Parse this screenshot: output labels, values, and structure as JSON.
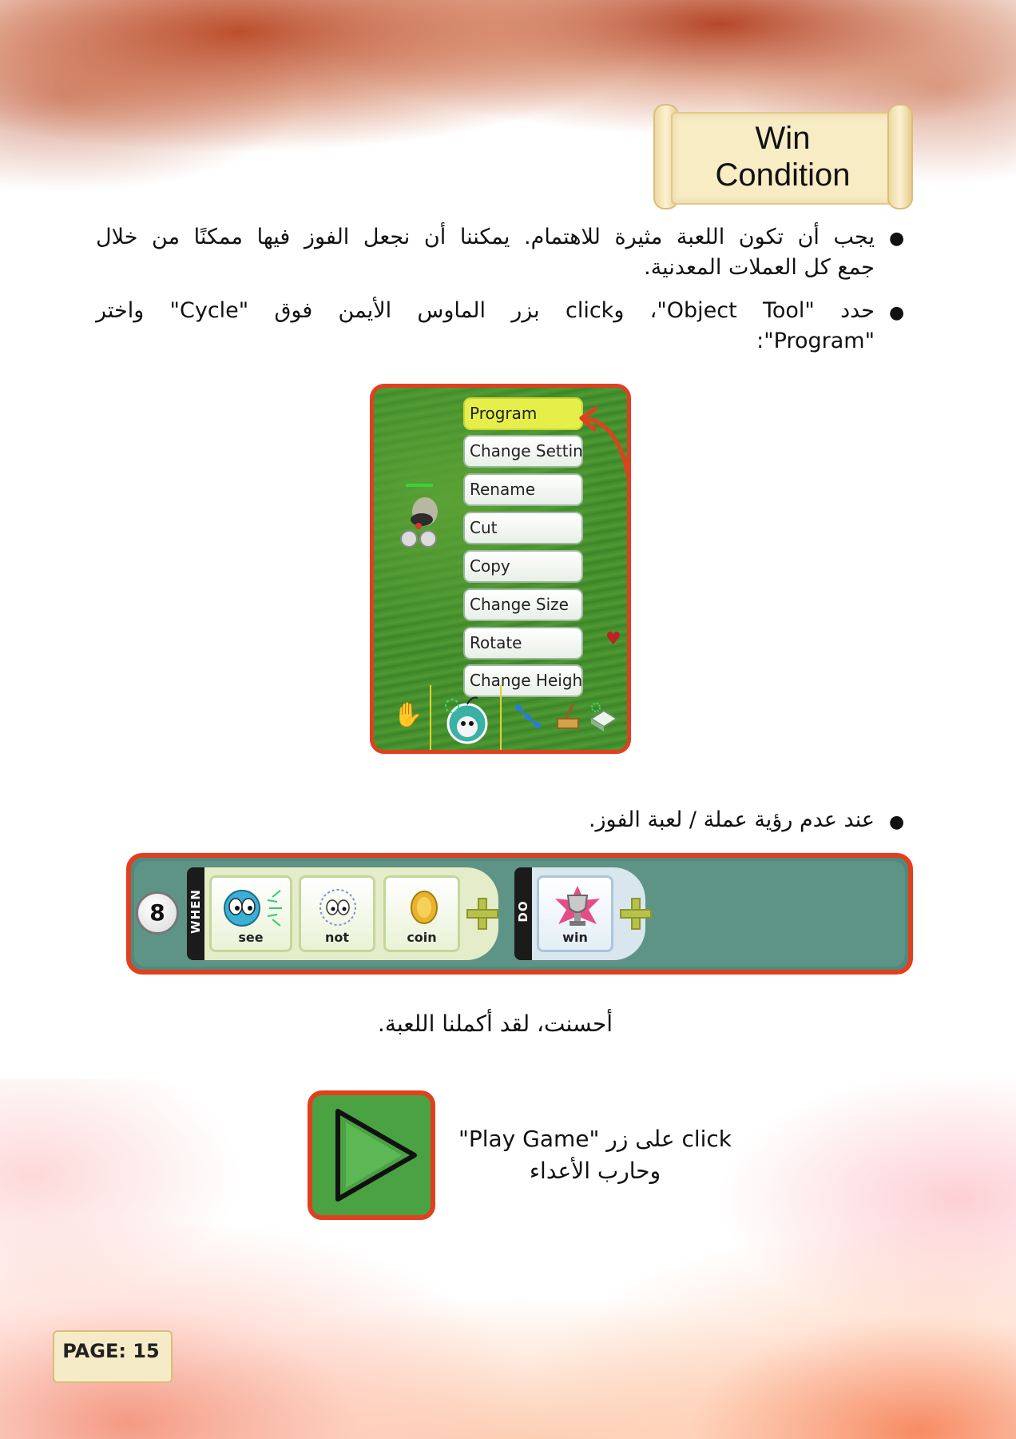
{
  "title": {
    "line1": "Win",
    "line2": "Condition"
  },
  "bullets": [
    {
      "line1": "يجب أن تكون اللعبة مثيرة للاهتمام. يمكننا أن نجعل الفوز فيها ممكنًا من خلال",
      "line2": "جمع كل العملات المعدنية."
    },
    {
      "line1": "حدد \"Object Tool\"، وclick بزر الماوس الأيمن فوق \"Cycle\" واختر",
      "line2": "\"Program\":"
    },
    {
      "line1": "عند عدم رؤية عملة / لعبة الفوز."
    }
  ],
  "context_menu": {
    "items": [
      "Program",
      "Change Settings",
      "Rename",
      "Cut",
      "Copy",
      "Change Size",
      "Rotate",
      "Change Height"
    ],
    "selected": "Program"
  },
  "program_row": {
    "number": "8",
    "when_label": "WHEN",
    "do_label": "DO",
    "when_tiles": [
      {
        "label": "see",
        "icon": "see-eyes-icon"
      },
      {
        "label": "not",
        "icon": "not-eyes-icon"
      },
      {
        "label": "coin",
        "icon": "coin-icon"
      }
    ],
    "do_tiles": [
      {
        "label": "win",
        "icon": "trophy-icon"
      }
    ]
  },
  "well_done": "أحسنت، لقد أكملنا اللعبة.",
  "play_instruction": {
    "line1": "click على زر \"Play Game\"",
    "line2": "وحارب الأعداء"
  },
  "page_label": "PAGE: 15",
  "colors": {
    "accent_red": "#e0401f",
    "grass_green": "#4f9a33",
    "menu_highlight": "#e6ef4a",
    "play_green": "#4ba243"
  }
}
